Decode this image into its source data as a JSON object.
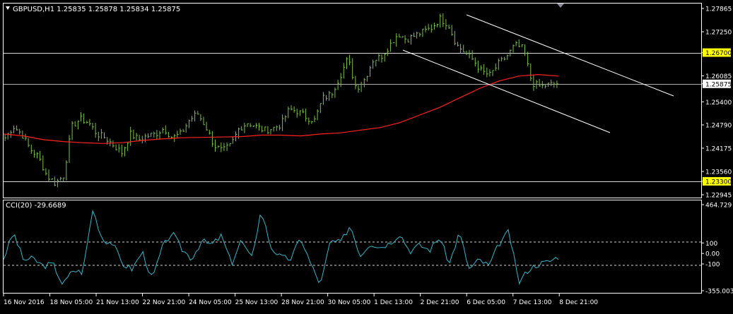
{
  "window": {
    "title": "GBPUSD,H1  1.25835 1.25878 1.25834 1.25875"
  },
  "colors": {
    "background": "#000000",
    "candles": "#7cbf4a",
    "moving_average": "#ff2020",
    "cci_line": "#3bb4c8",
    "channel": "#ffffff",
    "hline": "#d8d8d8",
    "price_badge_highlight": "#ffff00",
    "price_badge_current": "#ffffff",
    "axis_text": "#ffffff",
    "frame": "#ffffff"
  },
  "price_axis": {
    "labels": [
      "1.27865",
      "1.27250",
      "1.26700",
      "1.26085",
      "1.25875",
      "1.25400",
      "1.24790",
      "1.24175",
      "1.23560",
      "1.23300",
      "1.22945"
    ],
    "badges": [
      {
        "label": "1.26700",
        "kind": "hline"
      },
      {
        "label": "1.25875",
        "kind": "current"
      },
      {
        "label": "1.23300",
        "kind": "hline"
      }
    ]
  },
  "cci": {
    "label": "CCI(20) -29.6689",
    "axis_labels": [
      "464.729",
      "100",
      "0.00",
      "-100",
      "-355.0032"
    ],
    "levels": [
      100,
      -100
    ]
  },
  "time_axis": {
    "labels": [
      "16 Nov 2016",
      "18 Nov 05:00",
      "21 Nov 13:00",
      "22 Nov 21:00",
      "24 Nov 05:00",
      "25 Nov 13:00",
      "28 Nov 21:00",
      "30 Nov 05:00",
      "1 Dec 13:00",
      "2 Dec 21:00",
      "6 Dec 05:00",
      "7 Dec 13:00",
      "8 Dec 21:00"
    ]
  },
  "chart_data": {
    "type": "candlestick",
    "symbol": "GBPUSD",
    "timeframe": "H1",
    "ohlc_last": {
      "open": 1.25835,
      "high": 1.25878,
      "low": 1.25834,
      "close": 1.25875
    },
    "ylim": [
      1.22945,
      1.27865
    ],
    "hlines": [
      1.267,
      1.25875,
      1.233
    ],
    "channel": {
      "upper": {
        "start": [
          "6 Dec 05:00",
          1.2776
        ],
        "end": [
          "8 Dec 21:00+",
          1.2553
        ]
      },
      "lower": {
        "start": [
          "2 Dec 21:00-",
          1.2685
        ],
        "end": [
          "8 Dec 21:00+",
          1.2465
        ]
      }
    },
    "close_path": [
      1.2445,
      1.2475,
      1.2455,
      1.2415,
      1.2395,
      1.2345,
      1.2325,
      1.2345,
      1.2475,
      1.2495,
      1.2485,
      1.2455,
      1.2445,
      1.2425,
      1.2405,
      1.2455,
      1.244,
      1.245,
      1.2455,
      1.247,
      1.2445,
      1.2455,
      1.249,
      1.251,
      1.2475,
      1.2425,
      1.241,
      1.2425,
      1.247,
      1.2485,
      1.2475,
      1.2465,
      1.247,
      1.248,
      1.252,
      1.2515,
      1.25,
      1.249,
      1.255,
      1.256,
      1.2605,
      1.2655,
      1.2575,
      1.26,
      1.265,
      1.266,
      1.269,
      1.272,
      1.2705,
      1.2715,
      1.2725,
      1.2735,
      1.276,
      1.2745,
      1.269,
      1.267,
      1.265,
      1.262,
      1.261,
      1.264,
      1.266,
      1.269,
      1.268,
      1.259,
      1.258,
      1.2585,
      1.25875
    ],
    "ma_path": [
      1.2455,
      1.245,
      1.244,
      1.2435,
      1.2432,
      1.243,
      1.2432,
      1.2438,
      1.2442,
      1.2445,
      1.2446,
      1.2447,
      1.2448,
      1.2452,
      1.2452,
      1.245,
      1.2455,
      1.2458,
      1.2465,
      1.2472,
      1.2485,
      1.2505,
      1.2525,
      1.255,
      1.2575,
      1.2595,
      1.2608,
      1.2612,
      1.2608
    ],
    "cci_path": [
      -50,
      200,
      -60,
      -50,
      -120,
      -100,
      -300,
      -160,
      -180,
      420,
      130,
      100,
      -100,
      -150,
      20,
      -250,
      50,
      200,
      40,
      -50,
      120,
      80,
      170,
      -100,
      130,
      -60,
      410,
      60,
      -40,
      -50,
      150,
      -100,
      -300,
      120,
      100,
      270,
      -20,
      100,
      60,
      100,
      190,
      20,
      80,
      30,
      160,
      -100,
      200,
      -150,
      -60,
      -120,
      90,
      210,
      -280,
      -150,
      -100,
      -80,
      -30
    ]
  }
}
